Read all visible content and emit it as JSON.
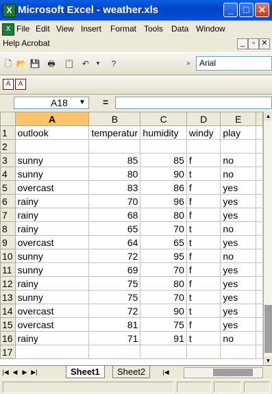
{
  "window": {
    "title": "Microsoft Excel - weather.xls",
    "app_icon": "excel-icon",
    "title_color": "#0043c8"
  },
  "menu": {
    "items": [
      "File",
      "Edit",
      "View",
      "Insert",
      "Format",
      "Tools",
      "Data",
      "Window"
    ],
    "row2": "Help Acrobat"
  },
  "toolbar": {
    "font": "Arial"
  },
  "formula_bar": {
    "name_box": "A18",
    "equals": "=",
    "formula": ""
  },
  "sheet": {
    "columns": [
      "A",
      "B",
      "C",
      "D",
      "E"
    ],
    "selected_column": "A",
    "rows": [
      {
        "n": "1",
        "cells": [
          "outlook",
          "temperatur",
          "humidity",
          "windy",
          "play"
        ]
      },
      {
        "n": "2",
        "cells": [
          "",
          "",
          "",
          "",
          ""
        ]
      },
      {
        "n": "3",
        "cells": [
          "sunny",
          "85",
          "85",
          "f",
          "no"
        ]
      },
      {
        "n": "4",
        "cells": [
          "sunny",
          "80",
          "90",
          "t",
          "no"
        ]
      },
      {
        "n": "5",
        "cells": [
          "overcast",
          "83",
          "86",
          "f",
          "yes"
        ]
      },
      {
        "n": "6",
        "cells": [
          "rainy",
          "70",
          "96",
          "f",
          "yes"
        ]
      },
      {
        "n": "7",
        "cells": [
          "rainy",
          "68",
          "80",
          "f",
          "yes"
        ]
      },
      {
        "n": "8",
        "cells": [
          "rainy",
          "65",
          "70",
          "t",
          "no"
        ]
      },
      {
        "n": "9",
        "cells": [
          "overcast",
          "64",
          "65",
          "t",
          "yes"
        ]
      },
      {
        "n": "10",
        "cells": [
          "sunny",
          "72",
          "95",
          "f",
          "no"
        ]
      },
      {
        "n": "11",
        "cells": [
          "sunny",
          "69",
          "70",
          "f",
          "yes"
        ]
      },
      {
        "n": "12",
        "cells": [
          "rainy",
          "75",
          "80",
          "f",
          "yes"
        ]
      },
      {
        "n": "13",
        "cells": [
          "sunny",
          "75",
          "70",
          "t",
          "yes"
        ]
      },
      {
        "n": "14",
        "cells": [
          "overcast",
          "72",
          "90",
          "t",
          "yes"
        ]
      },
      {
        "n": "15",
        "cells": [
          "overcast",
          "81",
          "75",
          "f",
          "yes"
        ]
      },
      {
        "n": "16",
        "cells": [
          "rainy",
          "71",
          "91",
          "t",
          "no"
        ]
      },
      {
        "n": "17",
        "cells": [
          "",
          "",
          "",
          "",
          ""
        ]
      }
    ]
  },
  "tabs": [
    {
      "label": "Sheet1",
      "active": true
    },
    {
      "label": "Sheet2",
      "active": false
    }
  ]
}
